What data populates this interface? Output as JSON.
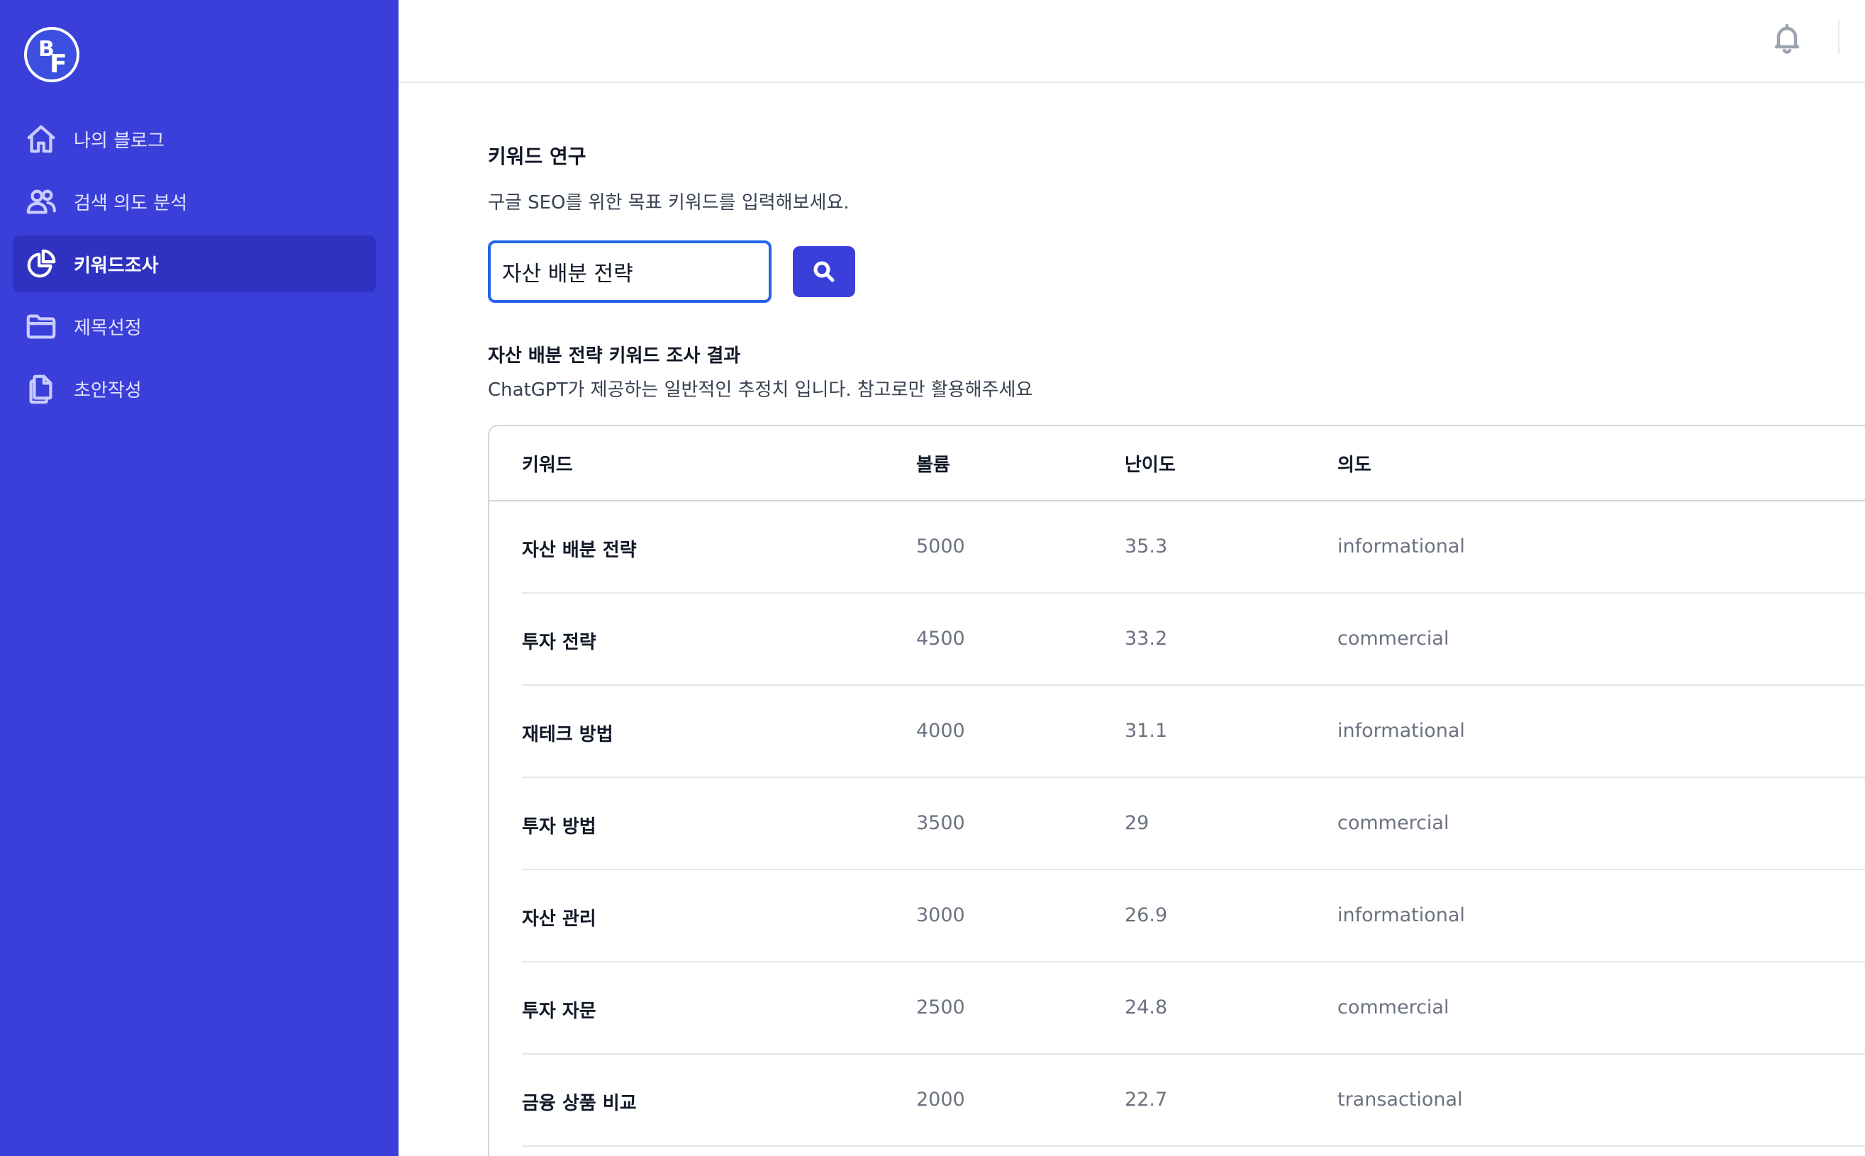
{
  "sidebar": {
    "items": [
      {
        "label": "나의 블로그",
        "icon": "home-icon"
      },
      {
        "label": "검색 의도 분석",
        "icon": "users-icon"
      },
      {
        "label": "키워드조사",
        "icon": "chart-pie-icon",
        "active": true
      },
      {
        "label": "제목선정",
        "icon": "folder-icon"
      },
      {
        "label": "초안작성",
        "icon": "documents-icon"
      }
    ]
  },
  "header": {
    "bell_icon": "bell-icon"
  },
  "main": {
    "title": "키워드 연구",
    "description": "구글 SEO를 위한 목표 키워드를 입력해보세요.",
    "search": {
      "value": "자산 배분 전략",
      "button_icon": "search-icon"
    },
    "result_title": "자산 배분 전략 키워드 조사 결과",
    "result_description": "ChatGPT가 제공하는 일반적인 추정치 입니다. 참고로만 활용해주세요",
    "table": {
      "columns": [
        "키워드",
        "볼륨",
        "난이도",
        "의도"
      ],
      "rows": [
        [
          "자산 배분 전략",
          "5000",
          "35.3",
          "informational"
        ],
        [
          "투자 전략",
          "4500",
          "33.2",
          "commercial"
        ],
        [
          "재테크 방법",
          "4000",
          "31.1",
          "informational"
        ],
        [
          "투자 방법",
          "3500",
          "29",
          "commercial"
        ],
        [
          "자산 관리",
          "3000",
          "26.9",
          "informational"
        ],
        [
          "투자 자문",
          "2500",
          "24.8",
          "commercial"
        ],
        [
          "금융 상품 비교",
          "2000",
          "22.7",
          "transactional"
        ]
      ]
    }
  },
  "colors": {
    "sidebar": "#3b3fd9",
    "sidebar_active": "#2f32c0",
    "accent": "#2563eb"
  }
}
